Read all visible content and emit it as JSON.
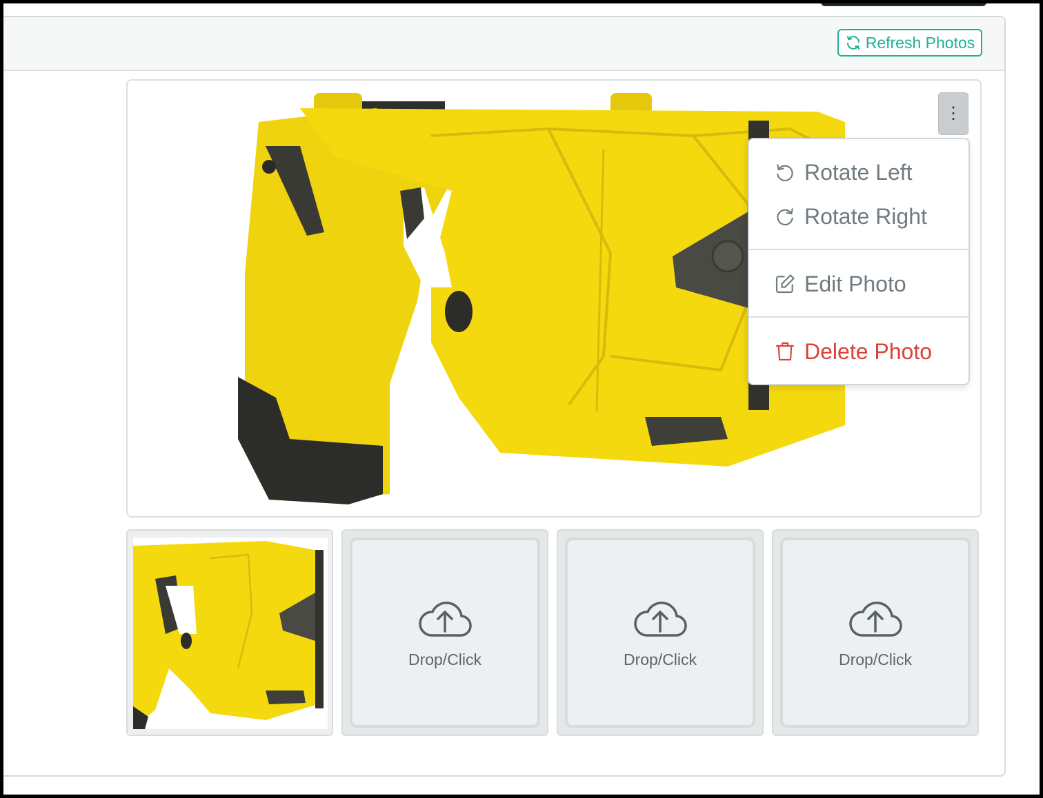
{
  "header": {
    "refresh_label": "Refresh Photos",
    "refresh_icon": "refresh-icon"
  },
  "main_photo": {
    "alt": "Yellow device photo",
    "menu_toggle": "⋮"
  },
  "photo_menu": {
    "items": [
      {
        "label": "Rotate Left",
        "icon": "rotate-left-icon"
      },
      {
        "label": "Rotate Right",
        "icon": "rotate-right-icon"
      },
      {
        "label": "Edit Photo",
        "icon": "edit-icon"
      },
      {
        "label": "Delete Photo",
        "icon": "trash-icon",
        "color": "#d9423a"
      }
    ]
  },
  "thumbnails": {
    "drop_slots": [
      {
        "label": "Drop/Click",
        "icon": "cloud-upload-icon"
      },
      {
        "label": "Drop/Click",
        "icon": "cloud-upload-icon"
      },
      {
        "label": "Drop/Click",
        "icon": "cloud-upload-icon"
      }
    ]
  },
  "colors": {
    "accent": "#1fb193",
    "danger": "#d9423a",
    "device_yellow": "#f5d90f"
  }
}
